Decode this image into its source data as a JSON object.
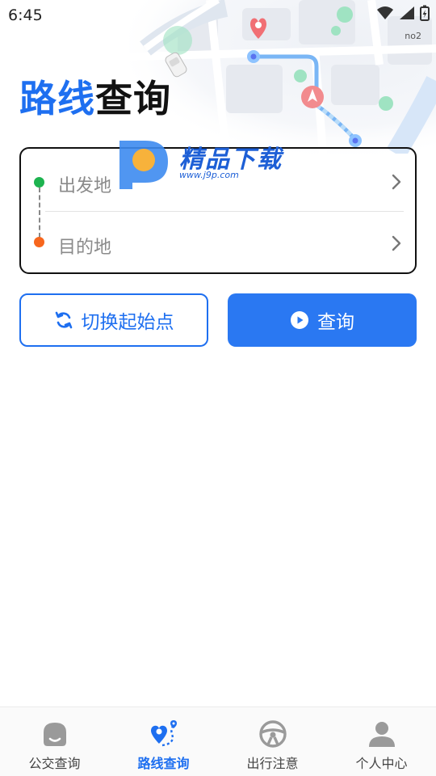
{
  "status_bar": {
    "time": "6:45",
    "sim_label": "no2"
  },
  "title": {
    "part1": "路线",
    "part2": "查询"
  },
  "watermark": {
    "name": "精品下载",
    "url": "www.j9p.com"
  },
  "locations": {
    "from_placeholder": "出发地",
    "to_placeholder": "目的地"
  },
  "actions": {
    "swap_label": "切换起始点",
    "query_label": "查询"
  },
  "bottom_nav": [
    {
      "label": "公交查询",
      "icon": "bus-icon",
      "active": false
    },
    {
      "label": "路线查询",
      "icon": "route-icon",
      "active": true
    },
    {
      "label": "出行注意",
      "icon": "steering-wheel-icon",
      "active": false
    },
    {
      "label": "个人中心",
      "icon": "person-icon",
      "active": false
    }
  ],
  "colors": {
    "accent": "#1e6ff0",
    "from_dot": "#1db34f",
    "to_dot": "#f7661d",
    "inactive_icon": "#9a9a9a"
  }
}
